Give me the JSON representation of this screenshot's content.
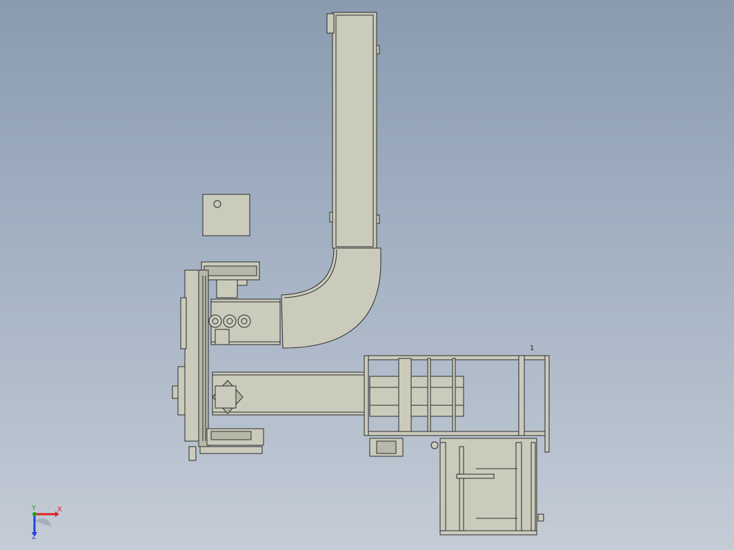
{
  "viewport": {
    "background_top": "#8a9bb0",
    "background_bottom": "#c4ccd6"
  },
  "model": {
    "part_fill": "#cbcbbc",
    "part_fill_dark": "#b8b8a8",
    "edge_color": "#2a2a2a",
    "panel_label": "1"
  },
  "triad": {
    "x_label": "X",
    "y_label": "Y",
    "z_label": "Z",
    "x_color": "#e02020",
    "y_color": "#20a020",
    "z_color": "#2040e0"
  }
}
